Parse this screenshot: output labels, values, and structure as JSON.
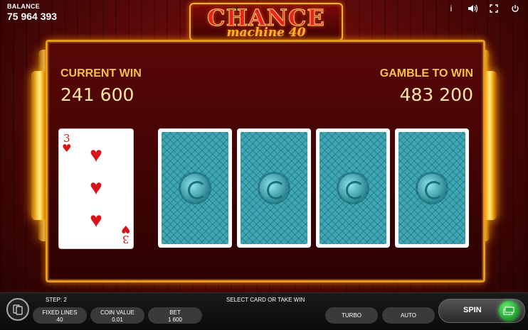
{
  "balance": {
    "label": "BALANCE",
    "value": "75 964 393"
  },
  "top_icons": [
    "info-icon",
    "sound-icon",
    "fullscreen-icon",
    "power-icon"
  ],
  "logo": {
    "main": "CHANCE",
    "sub": "machine 40"
  },
  "gamble": {
    "current_win_label": "CURRENT WIN",
    "current_win_value": "241 600",
    "gamble_to_win_label": "GAMBLE TO WIN",
    "gamble_to_win_value": "483 200",
    "dealer_card": {
      "rank": "3",
      "suit": "hearts"
    },
    "face_down_cards": 4
  },
  "bottom": {
    "step": "STEP: 2",
    "message": "SELECT CARD OR TAKE WIN",
    "fixed_lines_label": "FIXED LINES",
    "fixed_lines_value": "40",
    "coin_value_label": "COIN VALUE",
    "coin_value_value": "0.01",
    "bet_label": "BET",
    "bet_value": "1 600",
    "turbo_label": "TURBO",
    "auto_label": "AUTO",
    "spin_label": "SPIN"
  },
  "colors": {
    "accent_gold": "#f5c24a",
    "panel_red": "#5a0707",
    "card_back": "#3ea6b2",
    "spin_green": "#1c9a2a"
  }
}
